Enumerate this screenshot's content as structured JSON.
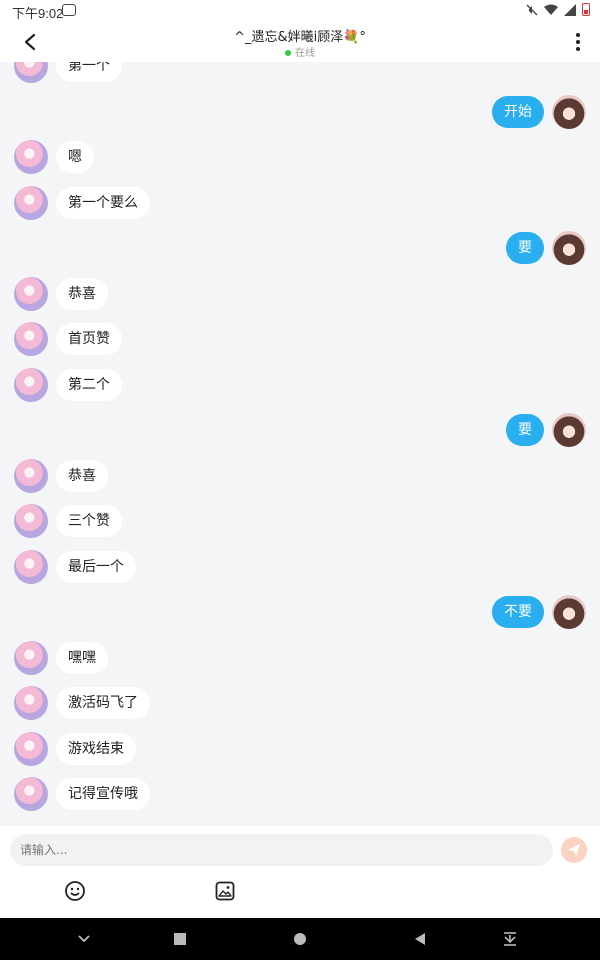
{
  "status_bar": {
    "time": "下午9:02"
  },
  "header": {
    "title": "^_遗忘&姅曦i顾泽💐°",
    "status": "在线",
    "back_icon": "back-arrow-icon",
    "more_icon": "more-vertical-icon"
  },
  "colors": {
    "accent": "#29aef0",
    "online": "#2ecc40",
    "background": "#f4f5f7"
  },
  "messages": [
    {
      "side": "left",
      "text": "第一个"
    },
    {
      "side": "right",
      "text": "开始"
    },
    {
      "side": "left",
      "text": "嗯"
    },
    {
      "side": "left",
      "text": "第一个要么"
    },
    {
      "side": "right",
      "text": "要"
    },
    {
      "side": "left",
      "text": "恭喜"
    },
    {
      "side": "left",
      "text": "首页赞"
    },
    {
      "side": "left",
      "text": "第二个"
    },
    {
      "side": "right",
      "text": "要"
    },
    {
      "side": "left",
      "text": "恭喜"
    },
    {
      "side": "left",
      "text": "三个赞"
    },
    {
      "side": "left",
      "text": "最后一个"
    },
    {
      "side": "right",
      "text": "不要"
    },
    {
      "side": "left",
      "text": "嘿嘿"
    },
    {
      "side": "left",
      "text": "激活码飞了"
    },
    {
      "side": "left",
      "text": "游戏结束"
    },
    {
      "side": "left",
      "text": "记得宣传哦"
    }
  ],
  "composer": {
    "placeholder": "请输入...",
    "send_icon": "send-icon",
    "emoji_icon": "emoji-icon",
    "image_icon": "image-icon"
  },
  "nav_bar": {
    "icons": [
      "collapse-keyboard-icon",
      "square-recents-icon",
      "circle-home-icon",
      "triangle-back-icon",
      "download-icon"
    ]
  }
}
